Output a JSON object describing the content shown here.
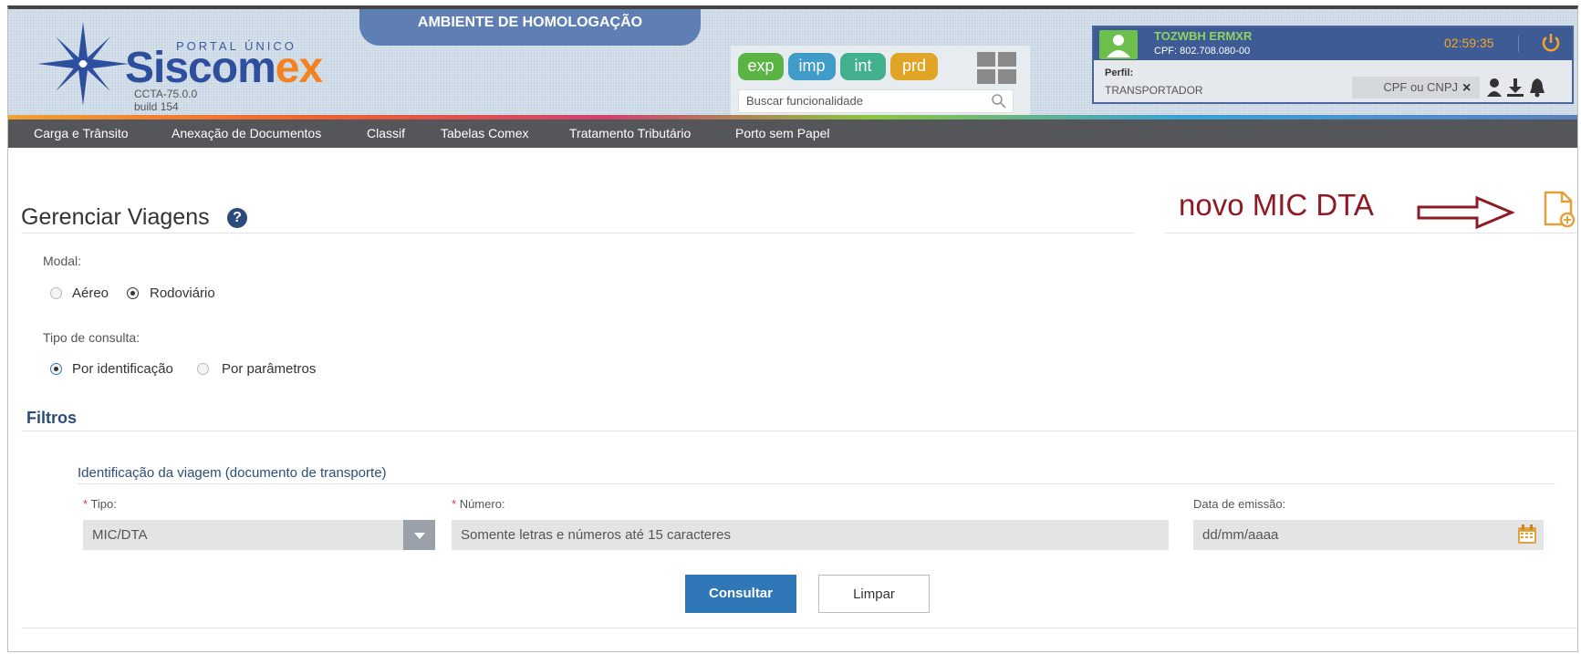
{
  "header": {
    "portal": "PORTAL ÚNICO",
    "brand_main": "Siscom",
    "brand_accent": "ex",
    "version": "CCTA-75.0.0",
    "build": "build 154",
    "ambiente": "AMBIENTE DE HOMOLOGAÇÃO",
    "apps": [
      {
        "label": "exp",
        "color": "#5bb343"
      },
      {
        "label": "imp",
        "color": "#3f9bc8"
      },
      {
        "label": "int",
        "color": "#42b08c"
      },
      {
        "label": "prd",
        "color": "#e0a526"
      }
    ],
    "search_placeholder": "Buscar funcionalidade",
    "user": {
      "name": "TOZWBH ERMXR",
      "cpf": "CPF: 802.708.080-00",
      "timer": "02:59:35",
      "perfil_label": "Perfil:",
      "perfil_value": "TRANSPORTADOR",
      "cpf_cnpj": "CPF ou CNPJ",
      "clear": "×"
    }
  },
  "menu": [
    "Carga e Trânsito",
    "Anexação de Documentos",
    "Classif",
    "Tabelas Comex",
    "Tratamento Tributário",
    "Porto sem Papel"
  ],
  "page": {
    "title": "Gerenciar Viagens",
    "help": "?",
    "annotation": "novo MIC DTA",
    "modal_label": "Modal:",
    "modal_options": [
      "Aéreo",
      "Rodoviário"
    ],
    "modal_selected": "Rodoviário",
    "tipo_consulta_label": "Tipo de consulta:",
    "tipo_consulta_options": [
      "Por identificação",
      "Por parâmetros"
    ],
    "tipo_consulta_selected": "Por identificação",
    "filtros": "Filtros",
    "fieldset_title": "Identificação da viagem (documento de transporte)",
    "required_mark": "*",
    "tipo_label": "Tipo:",
    "tipo_value": "MIC/DTA",
    "numero_label": "Número:",
    "numero_placeholder": "Somente letras e números até 15 caracteres",
    "data_label": "Data de emissão:",
    "data_placeholder": "dd/mm/aaaa",
    "consultar": "Consultar",
    "limpar": "Limpar"
  }
}
